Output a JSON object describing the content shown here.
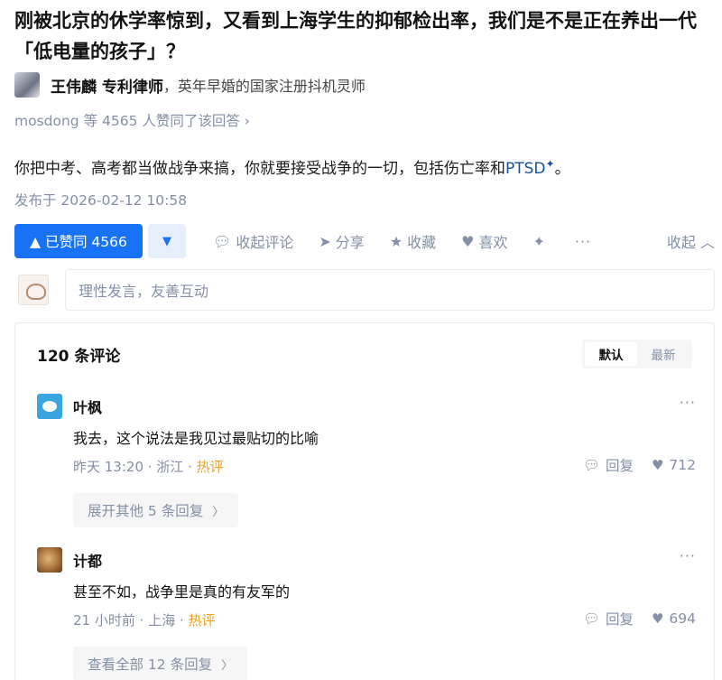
{
  "question": {
    "title": "刚被北京的休学率惊到，又看到上海学生的抑郁检出率，我们是不是正在养出一代「低电量的孩子」？"
  },
  "answer": {
    "author_name": "王伟麟 专利律师",
    "author_desc": "，英年早婚的国家注册抖机灵师",
    "likers_text": "mosdong 等 4565 人赞同了该回答 ›",
    "content_text": "你把中考、高考都当做战争来搞，你就要接受战争的一切，包括伤亡率和",
    "content_link": "PTSD",
    "content_end": "。",
    "date": "发布于 2026-02-12 10:58"
  },
  "actions": {
    "vote_up": "▲ 已赞同 4566",
    "vote_down": "▼",
    "comment": "收起评论",
    "share": "分享",
    "collect": "收藏",
    "like": "喜欢",
    "more": "···",
    "collapse": "收起 ︿"
  },
  "comment_input": {
    "placeholder": "理性发言，友善互动"
  },
  "comments": {
    "header": "120 条评论",
    "sort_default": "默认",
    "sort_latest": "最新",
    "items": [
      {
        "name": "叶枫",
        "more": "···",
        "text": "我去，这个说法是我见过最贴切的比喻",
        "time": "昨天 13:20",
        "location": "浙江",
        "hot": "热评",
        "reply": "回复",
        "likes": "712",
        "expand": "展开其他 5 条回复"
      },
      {
        "name": "计都",
        "more": "···",
        "text": "甚至不如，战争里是真的有友军的",
        "time": "21 小时前",
        "location": "上海",
        "hot": "热评",
        "reply": "回复",
        "likes": "694",
        "expand": "查看全部 12 条回复"
      }
    ]
  },
  "colors": {
    "brand_blue": "#1772f6",
    "meta_gray": "#8590a6",
    "hot_orange": "#f0a020",
    "link_blue": "#175199"
  }
}
